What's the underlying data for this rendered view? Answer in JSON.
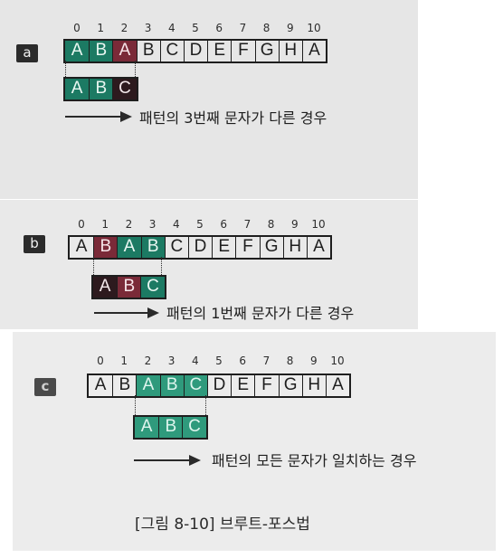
{
  "indices": [
    "0",
    "1",
    "2",
    "3",
    "4",
    "5",
    "6",
    "7",
    "8",
    "9",
    "10"
  ],
  "text_chars": [
    "A",
    "B",
    "A",
    "B",
    "C",
    "D",
    "E",
    "F",
    "G",
    "H",
    "A"
  ],
  "pattern_chars": [
    "A",
    "B",
    "C"
  ],
  "panels": {
    "a": {
      "badge": "a",
      "caption": "패턴의 3번째 문자가 다른 경우"
    },
    "b": {
      "badge": "b",
      "caption": "패턴의 1번째 문자가 다른 경우"
    },
    "c": {
      "badge": "c",
      "caption": "패턴의 모든 문자가 일치하는 경우"
    }
  },
  "figure_title": "[그림 8-10] 브루트-포스법"
}
